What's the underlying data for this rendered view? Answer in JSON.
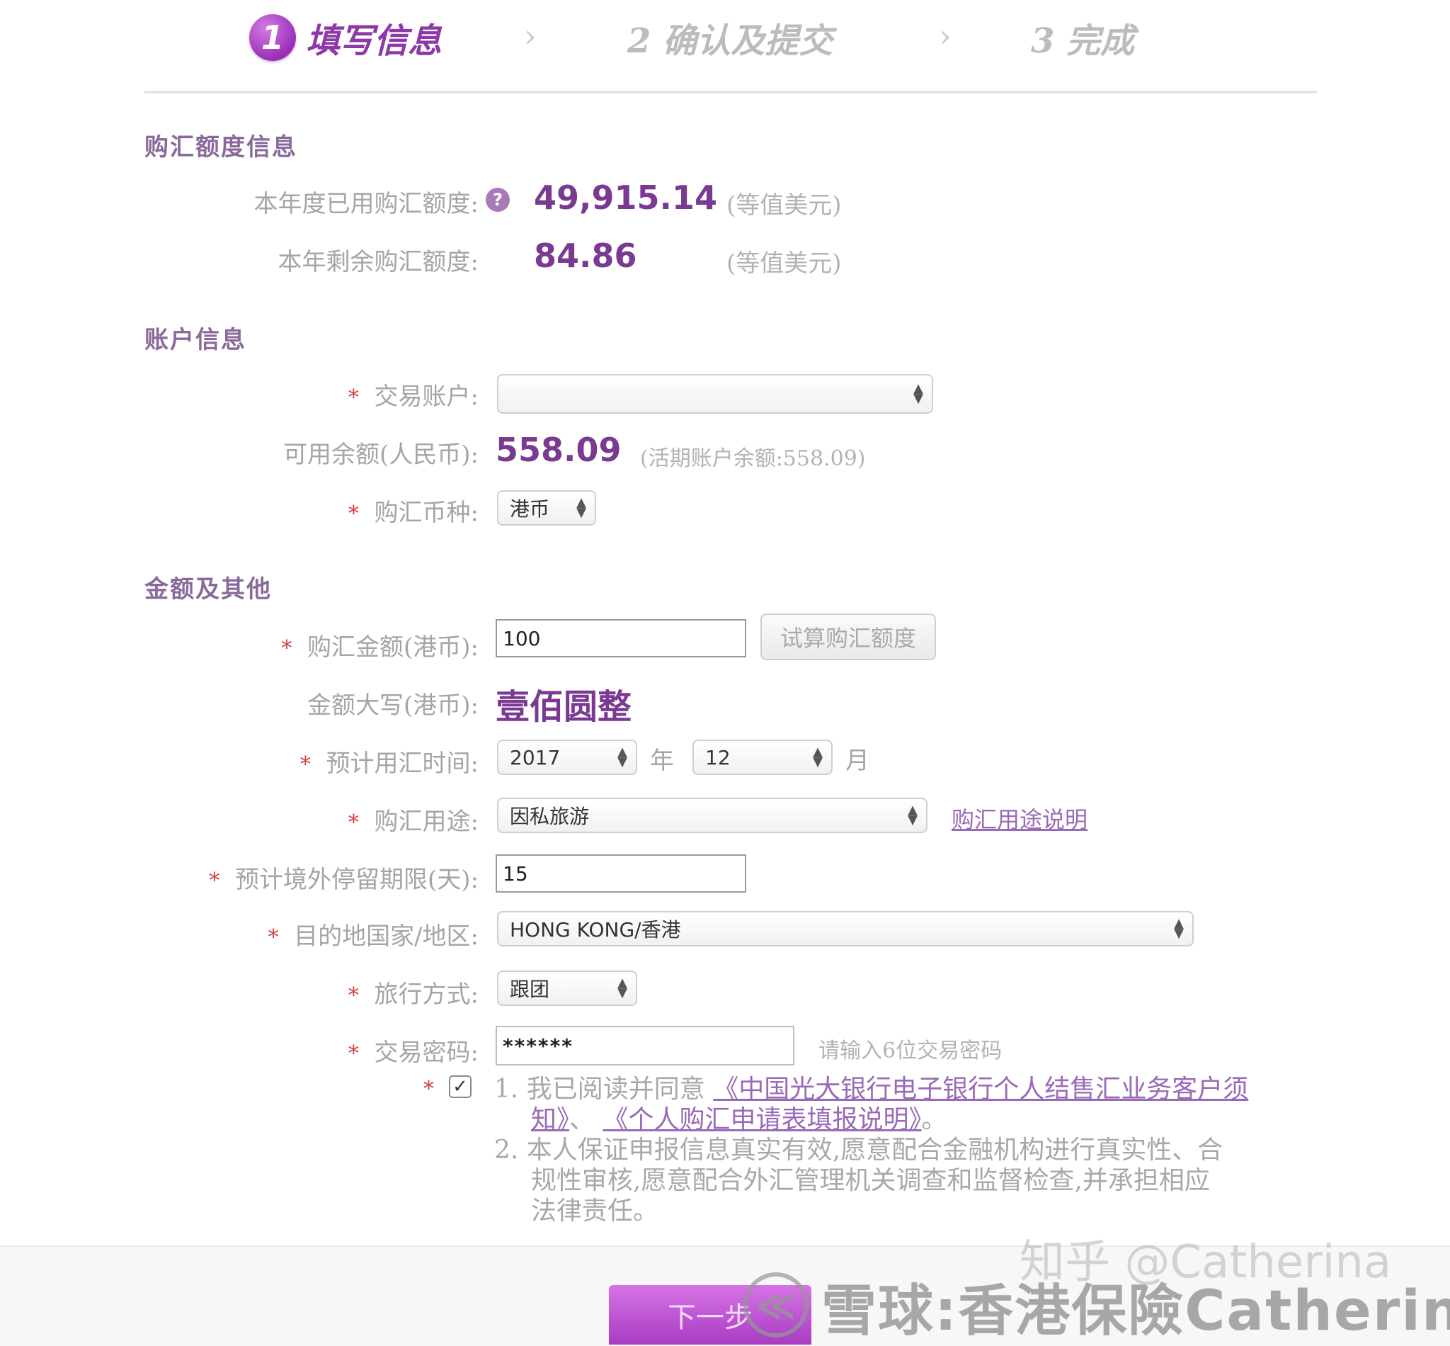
{
  "steps": {
    "step1_num": "1",
    "step1_label": "填写信息",
    "step2_label": "2 确认及提交",
    "step3_label": "3 完成",
    "separator": "›"
  },
  "quota": {
    "section_title": "购汇额度信息",
    "used_label": "本年度已用购汇额度:",
    "used_value": "49,915.14",
    "used_unit": "(等值美元)",
    "remain_label": "本年剩余购汇额度:",
    "remain_value": "84.86",
    "remain_unit": "(等值美元)",
    "help_icon": "?"
  },
  "account": {
    "section_title": "账户信息",
    "account_label": "交易账户:",
    "account_value": "",
    "balance_label": "可用余额(人民币):",
    "balance_value": "558.09",
    "balance_note": "(活期账户余额:558.09)",
    "currency_label": "购汇币种:",
    "currency_value": "港币"
  },
  "amount": {
    "section_title": "金额及其他",
    "amount_label": "购汇金额(港币):",
    "amount_value": "100",
    "calc_button": "试算购汇额度",
    "upper_label": "金额大写(港币):",
    "upper_value": "壹佰圆整",
    "time_label": "预计用汇时间:",
    "year_value": "2017",
    "year_unit": "年",
    "month_value": "12",
    "month_unit": "月",
    "purpose_label": "购汇用途:",
    "purpose_value": "因私旅游",
    "purpose_link": "购汇用途说明",
    "stay_label": "预计境外停留期限(天):",
    "stay_value": "15",
    "dest_label": "目的地国家/地区:",
    "dest_value": "HONG KONG/香港",
    "travel_label": "旅行方式:",
    "travel_value": "跟团",
    "pwd_label": "交易密码:",
    "pwd_value": "******",
    "pwd_hint": "请输入6位交易密码"
  },
  "agreement": {
    "line1_prefix": "1. 我已阅读并同意",
    "doc1_a": "《中国光大银行电子银行个人结售汇业务客户须",
    "doc1_b": "知》",
    "sep": "、",
    "doc2": "《个人购汇申请表填报说明》",
    "end": "。",
    "line2a": "2. 本人保证申报信息真实有效,愿意配合金融机构进行真实性、合",
    "line2b": "规性审核,愿意配合外汇管理机关调查和监督检查,并承担相应",
    "line2c": "法律责任。",
    "checked_mark": "✓"
  },
  "required_mark": "*",
  "next_button": "下一步",
  "watermarks": {
    "zhihu": "知乎 @Catherina",
    "xueqiu": "雪球:香港保險Catherina",
    "logo": "≪"
  }
}
